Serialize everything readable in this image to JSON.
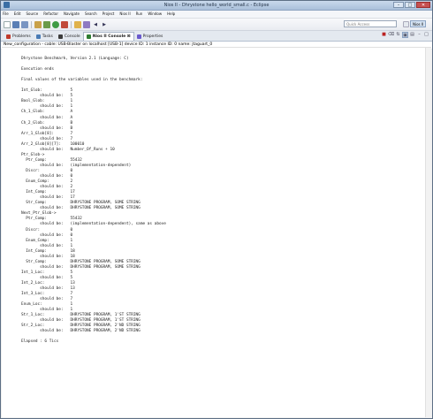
{
  "window": {
    "title": "Nios II - Dhrystone hello_world_small.c - Eclipse",
    "minimize": "–",
    "maximize": "□",
    "close": "✕"
  },
  "menu": [
    "File",
    "Edit",
    "Source",
    "Refactor",
    "Navigate",
    "Search",
    "Project",
    "Nios II",
    "Run",
    "Window",
    "Help"
  ],
  "toolbar": {
    "quick_access_placeholder": "Quick Access",
    "perspective_label": "Nios II"
  },
  "tabs": [
    {
      "label": "Problems",
      "icon_color": "#c03a2b"
    },
    {
      "label": "Tasks",
      "icon_color": "#4a7bb5"
    },
    {
      "label": "Console",
      "icon_color": "#3c3c3c"
    },
    {
      "label": "Nios II Console ⊠",
      "icon_color": "#2e7d32"
    },
    {
      "label": "Properties",
      "icon_color": "#6a5acd"
    }
  ],
  "console": {
    "header": "New_configuration - cable: USB-Blaster on localhost [USB-1] device ID: 1 instance ID: 0 name: jtaguart_0",
    "lines": [
      "Dhrystone Benchmark, Version 2.1 (Language: C)",
      "",
      "Execution ends",
      "",
      "Final values of the variables used in the benchmark:",
      "",
      "Int_Glob:            5",
      "        should be:   5",
      "Bool_Glob:           1",
      "        should be:   1",
      "Ch_1_Glob:           A",
      "        should be:   A",
      "Ch_2_Glob:           B",
      "        should be:   B",
      "Arr_1_Glob[8]:       7",
      "        should be:   7",
      "Arr_2_Glob[8][7]:    100010",
      "        should be:   Number_Of_Runs + 10",
      "Ptr_Glob->",
      "  Ptr_Comp:          55432",
      "        should be:   (implementation-dependent)",
      "  Discr:             0",
      "        should be:   0",
      "  Enum_Comp:         2",
      "        should be:   2",
      "  Int_Comp:          17",
      "        should be:   17",
      "  Str_Comp:          DHRYSTONE PROGRAM, SOME STRING",
      "        should be:   DHRYSTONE PROGRAM, SOME STRING",
      "Next_Ptr_Glob->",
      "  Ptr_Comp:          55432",
      "        should be:   (implementation-dependent), same as above",
      "  Discr:             0",
      "        should be:   0",
      "  Enum_Comp:         1",
      "        should be:   1",
      "  Int_Comp:          18",
      "        should be:   18",
      "  Str_Comp:          DHRYSTONE PROGRAM, SOME STRING",
      "        should be:   DHRYSTONE PROGRAM, SOME STRING",
      "Int_1_Loc:           5",
      "        should be:   5",
      "Int_2_Loc:           13",
      "        should be:   13",
      "Int_3_Loc:           7",
      "        should be:   7",
      "Enum_Loc:            1",
      "        should be:   1",
      "Str_1_Loc:           DHRYSTONE PROGRAM, 1'ST STRING",
      "        should be:   DHRYSTONE PROGRAM, 1'ST STRING",
      "Str_2_Loc:           DHRYSTONE PROGRAM, 2'ND STRING",
      "        should be:   DHRYSTONE PROGRAM, 2'ND STRING",
      "",
      "Elapsed : 6 Tics"
    ]
  }
}
